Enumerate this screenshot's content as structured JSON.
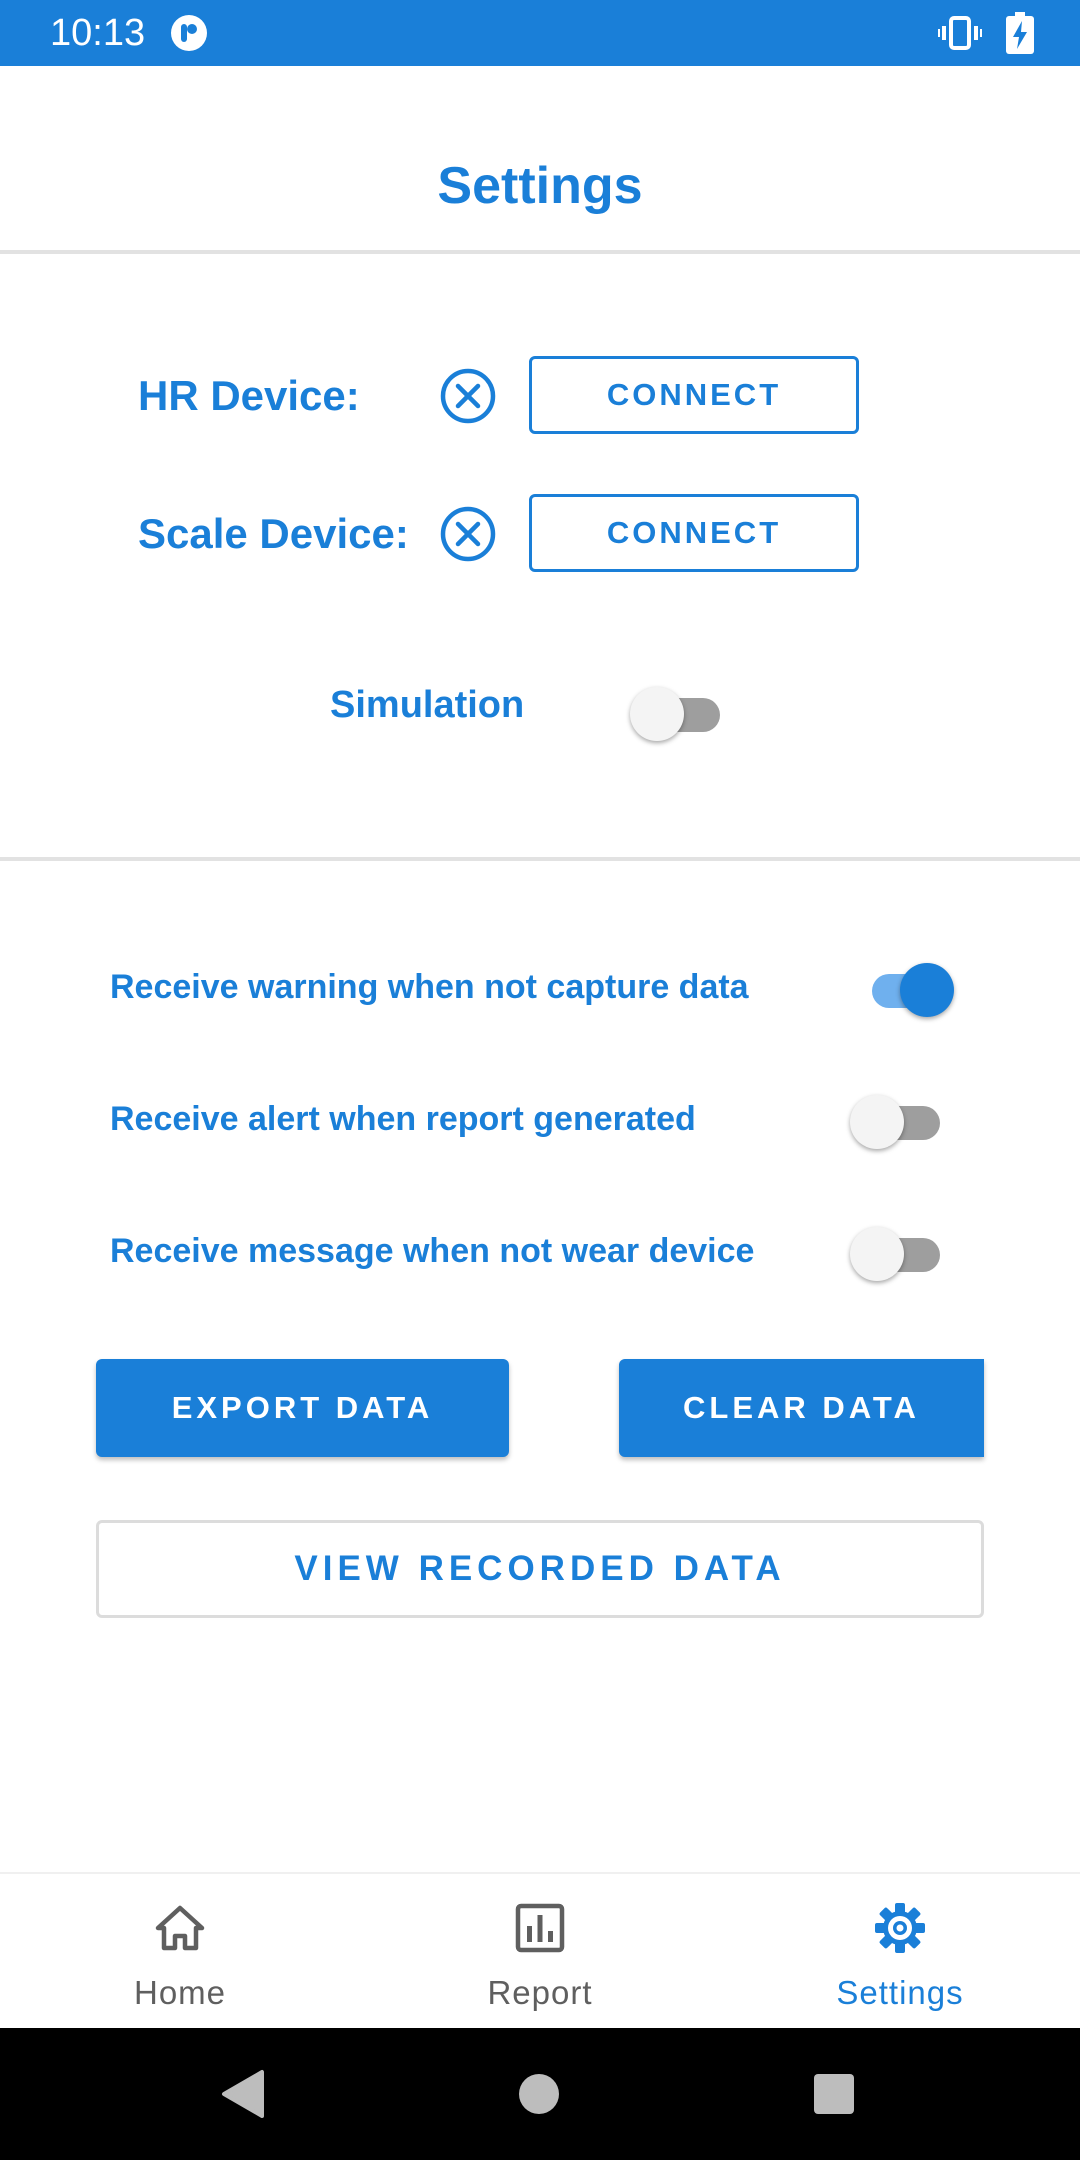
{
  "status_bar": {
    "time": "10:13",
    "app_icon": "app-notification-icon",
    "vibrate_icon": "vibrate-icon",
    "battery_icon": "battery-charging-icon"
  },
  "header": {
    "title": "Settings"
  },
  "devices": [
    {
      "label": "HR Device:",
      "status_icon": "disconnected-x-icon",
      "button_label": "CONNECT"
    },
    {
      "label": "Scale Device:",
      "status_icon": "disconnected-x-icon",
      "button_label": "CONNECT"
    }
  ],
  "simulation": {
    "label": "Simulation",
    "enabled": false
  },
  "preferences": [
    {
      "label": "Receive warning when not capture data",
      "enabled": true
    },
    {
      "label": "Receive alert when report generated",
      "enabled": false
    },
    {
      "label": "Receive message when not wear device",
      "enabled": false
    }
  ],
  "actions": {
    "export_label": "EXPORT DATA",
    "clear_label": "CLEAR DATA",
    "view_label": "VIEW RECORDED DATA"
  },
  "bottom_nav": {
    "items": [
      {
        "label": "Home",
        "icon": "home-icon",
        "active": false
      },
      {
        "label": "Report",
        "icon": "report-chart-icon",
        "active": false
      },
      {
        "label": "Settings",
        "icon": "gear-icon",
        "active": true
      }
    ]
  },
  "colors": {
    "accent": "#1a7fd8",
    "divider": "#e2e2e2",
    "inactive_nav": "#5f5f5f"
  }
}
